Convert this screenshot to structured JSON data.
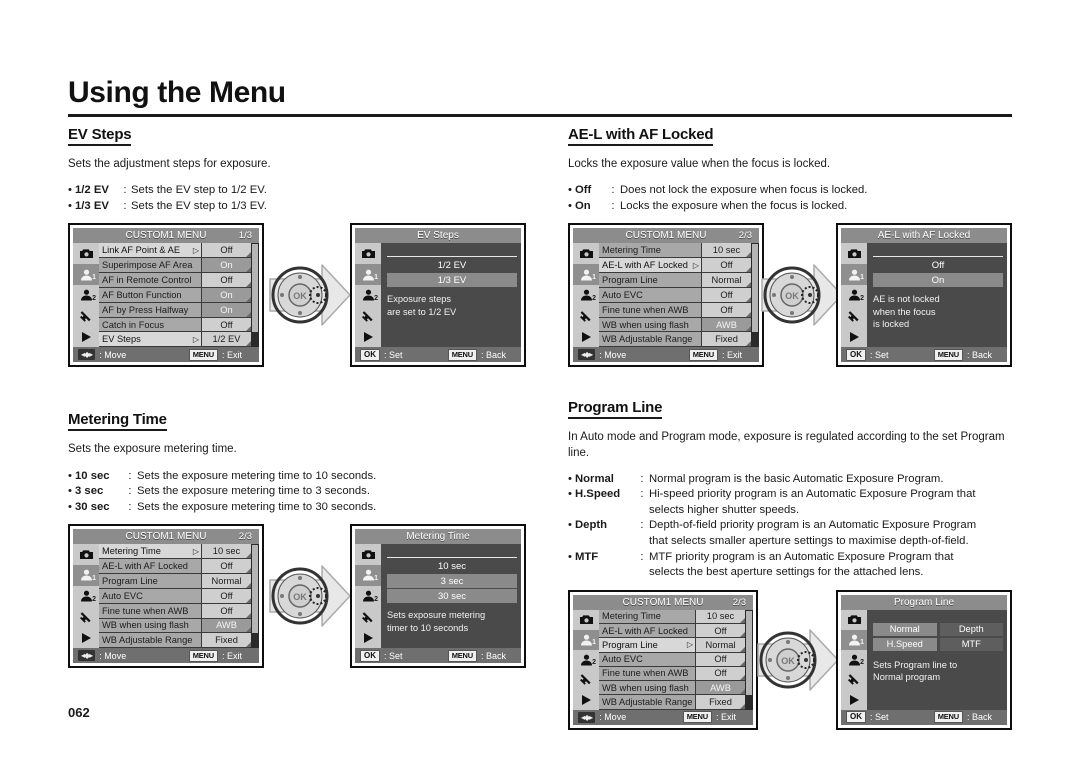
{
  "page": {
    "title": "Using the Menu",
    "number": "062"
  },
  "sections": {
    "ev_steps": {
      "heading": "EV Steps",
      "description": "Sets the adjustment steps for exposure.",
      "options": [
        {
          "term": "1/2 EV",
          "definition": "Sets the EV step to 1/2 EV."
        },
        {
          "term": "1/3 EV",
          "definition": "Sets the EV step to 1/3 EV."
        }
      ]
    },
    "metering_time": {
      "heading": "Metering Time",
      "description": "Sets the exposure metering time.",
      "options": [
        {
          "term": "10 sec",
          "definition": "Sets the exposure metering time to 10 seconds."
        },
        {
          "term": "3 sec",
          "definition": "Sets the exposure metering time to 3 seconds."
        },
        {
          "term": "30 sec",
          "definition": "Sets the exposure metering time to 30 seconds."
        }
      ]
    },
    "ael_af_locked": {
      "heading": "AE-L with AF Locked",
      "description": "Locks the exposure value when the focus is locked.",
      "options": [
        {
          "term": "Off",
          "definition": "Does not lock the exposure when focus is locked."
        },
        {
          "term": "On",
          "definition": "Locks the exposure when the focus is locked."
        }
      ]
    },
    "program_line": {
      "heading": "Program Line",
      "description": "In Auto mode and Program mode, exposure is regulated according to the set Program line.",
      "options": [
        {
          "term": "Normal",
          "definition": "Normal program is the basic Automatic Exposure Program.",
          "continuation": ""
        },
        {
          "term": "H.Speed",
          "definition": "Hi-speed priority program is an Automatic Exposure Program that",
          "continuation": "selects higher shutter speeds."
        },
        {
          "term": "Depth",
          "definition": "Depth-of-field priority program is an Automatic Exposure Program",
          "continuation": "that selects smaller aperture settings to maximise depth-of-field."
        },
        {
          "term": "MTF",
          "definition": "MTF priority program is an Automatic Exposure Program that",
          "continuation": "selects the best aperture settings for the attached lens."
        }
      ]
    }
  },
  "lcd": {
    "footer_move": ": Move",
    "footer_exit": ": Exit",
    "footer_set": ": Set",
    "footer_back": ": Back",
    "badge_menu": "MENU",
    "badge_ok": "OK",
    "rail_icons": [
      "camera-icon",
      "person1-icon",
      "person2-icon",
      "wrench-icon",
      "play-icon"
    ],
    "rail_sub_1": "1",
    "rail_sub_2": "2"
  },
  "menus": {
    "custom1_page1": {
      "title": "CUSTOM1 MENU",
      "page": "1/3",
      "rows": [
        {
          "label": "Link AF Point & AE",
          "value": "Off",
          "selected": false,
          "value_style": "light"
        },
        {
          "label": "Superimpose AF Area",
          "value": "On",
          "selected": false,
          "value_style": "light"
        },
        {
          "label": "AF in Remote Control",
          "value": "Off",
          "selected": false,
          "value_style": "light"
        },
        {
          "label": "AF Button Function",
          "value": "On",
          "selected": false,
          "value_style": "dark"
        },
        {
          "label": "AF by Press Halfway",
          "value": "On",
          "selected": false,
          "value_style": "dark"
        },
        {
          "label": "Catch in Focus",
          "value": "Off",
          "selected": false,
          "value_style": "light"
        },
        {
          "label": "EV Steps",
          "value": "1/2 EV",
          "selected": true,
          "value_style": "light"
        }
      ]
    },
    "custom1_page2_metering": {
      "title": "CUSTOM1 MENU",
      "page": "2/3",
      "rows": [
        {
          "label": "Metering Time",
          "value": "10 sec",
          "selected": true,
          "value_style": "light"
        },
        {
          "label": "AE-L with AF Locked",
          "value": "Off",
          "selected": false,
          "value_style": "light"
        },
        {
          "label": "Program Line",
          "value": "Normal",
          "selected": false,
          "value_style": "light"
        },
        {
          "label": "Auto EVC",
          "value": "Off",
          "selected": false,
          "value_style": "light"
        },
        {
          "label": "Fine tune when AWB",
          "value": "Off",
          "selected": false,
          "value_style": "light"
        },
        {
          "label": "WB when using flash",
          "value": "AWB",
          "selected": false,
          "value_style": "dark"
        },
        {
          "label": "WB Adjustable Range",
          "value": "Fixed",
          "selected": false,
          "value_style": "light"
        }
      ]
    },
    "custom1_page2_ael": {
      "title": "CUSTOM1 MENU",
      "page": "2/3",
      "rows": [
        {
          "label": "Metering Time",
          "value": "10 sec",
          "selected": false,
          "value_style": "light"
        },
        {
          "label": "AE-L with AF Locked",
          "value": "Off",
          "selected": true,
          "value_style": "light"
        },
        {
          "label": "Program Line",
          "value": "Normal",
          "selected": false,
          "value_style": "light"
        },
        {
          "label": "Auto EVC",
          "value": "Off",
          "selected": false,
          "value_style": "light"
        },
        {
          "label": "Fine tune when AWB",
          "value": "Off",
          "selected": false,
          "value_style": "light"
        },
        {
          "label": "WB when using flash",
          "value": "AWB",
          "selected": false,
          "value_style": "dark"
        },
        {
          "label": "WB Adjustable Range",
          "value": "Fixed",
          "selected": false,
          "value_style": "light"
        }
      ]
    },
    "custom1_page2_program": {
      "title": "CUSTOM1 MENU",
      "page": "2/3",
      "rows": [
        {
          "label": "Metering Time",
          "value": "10 sec",
          "selected": false,
          "value_style": "light"
        },
        {
          "label": "AE-L with AF Locked",
          "value": "Off",
          "selected": false,
          "value_style": "light"
        },
        {
          "label": "Program Line",
          "value": "Normal",
          "selected": true,
          "value_style": "light"
        },
        {
          "label": "Auto EVC",
          "value": "Off",
          "selected": false,
          "value_style": "light"
        },
        {
          "label": "Fine tune when AWB",
          "value": "Off",
          "selected": false,
          "value_style": "light"
        },
        {
          "label": "WB when using flash",
          "value": "AWB",
          "selected": false,
          "value_style": "dark"
        },
        {
          "label": "WB Adjustable Range",
          "value": "Fixed",
          "selected": false,
          "value_style": "light"
        }
      ]
    }
  },
  "detail_panels": {
    "ev_steps": {
      "title": "EV Steps",
      "options": [
        {
          "label": "1/2 EV",
          "highlighted": false
        },
        {
          "label": "1/3 EV",
          "highlighted": true
        }
      ],
      "note_line1": "Exposure steps",
      "note_line2": "are set to 1/2 EV",
      "note_line3": ""
    },
    "metering_time": {
      "title": "Metering Time",
      "options": [
        {
          "label": "10 sec",
          "highlighted": false
        },
        {
          "label": "3 sec",
          "highlighted": true
        },
        {
          "label": "30 sec",
          "highlighted": true
        }
      ],
      "note_line1": "Sets exposure metering",
      "note_line2": "timer to 10 seconds",
      "note_line3": ""
    },
    "ael_af_locked": {
      "title": "AE-L with AF Locked",
      "options": [
        {
          "label": "Off",
          "highlighted": false
        },
        {
          "label": "On",
          "highlighted": true
        }
      ],
      "note_line1": "AE is not locked",
      "note_line2": "when the focus",
      "note_line3": "is locked"
    },
    "program_line": {
      "title": "Program Line",
      "grid": [
        {
          "label": "Normal",
          "dark": false
        },
        {
          "label": "Depth",
          "dark": true
        },
        {
          "label": "H.Speed",
          "dark": false
        },
        {
          "label": "MTF",
          "dark": true
        }
      ],
      "note_line1": "Sets Program line to",
      "note_line2": "Normal program",
      "note_line3": ""
    }
  }
}
